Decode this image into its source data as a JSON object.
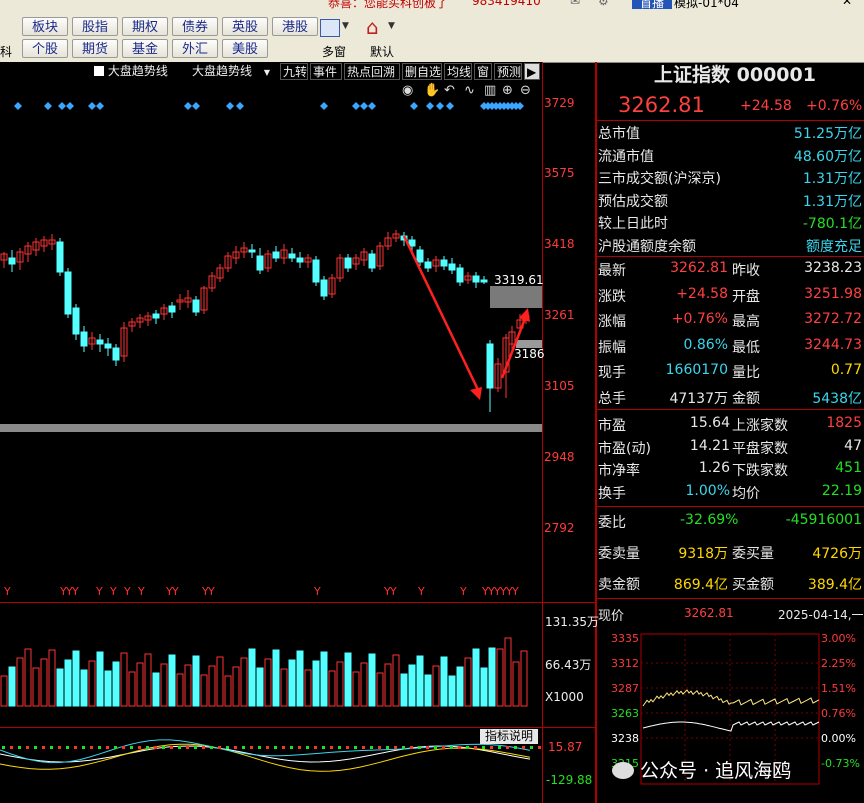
{
  "top_strip": {
    "text": "恭喜：您能买科创板了",
    "code": "983419410",
    "status_btn": "首播",
    "mode": "模拟-01*04"
  },
  "toolbar": {
    "row1": [
      "板块",
      "股指",
      "期权",
      "债券",
      "英股",
      "港股"
    ],
    "row2": [
      "个股",
      "期货",
      "基金",
      "外汇",
      "美股"
    ],
    "side_label": "科",
    "multi_window": "多窗",
    "default": "默认"
  },
  "chart_tools": {
    "checkbox_label": "大盘趋势线",
    "dropdown_label": "大盘趋势线",
    "buttons": [
      "九转",
      "事件",
      "热点回溯",
      "删自选",
      "均线",
      "窗",
      "预测"
    ]
  },
  "price_axis": [
    "3729",
    "3575",
    "3418",
    "3261",
    "3105",
    "2948",
    "2792"
  ],
  "price_marks": {
    "high_label": "3319.61",
    "low_label": "3186"
  },
  "volume_axis": {
    "top": "131.35万",
    "mid": "66.43万",
    "unit": "X1000"
  },
  "indicator": {
    "button": "指标说明",
    "top": "15.87",
    "bottom": "-129.88"
  },
  "y_markers": "Y YYY Y Y Y Y YY YY Y YY Y Y YYYYY",
  "title": "上证指数 000001",
  "price": "3262.81",
  "change": "+24.58",
  "change_pct": "+0.76%",
  "summary": [
    {
      "label": "总市值",
      "value": "51.25万亿",
      "color": "cy"
    },
    {
      "label": "流通市值",
      "value": "48.60万亿",
      "color": "cy"
    },
    {
      "label": "三市成交额(沪深京)",
      "value": "1.31万亿",
      "color": "cy"
    },
    {
      "label": "预估成交额",
      "value": "1.31万亿",
      "color": "cy"
    },
    {
      "label": "较上日此时",
      "value": "-780.1亿",
      "color": "gr"
    },
    {
      "label": "沪股通额度余额",
      "value": "额度充足",
      "color": "cy"
    }
  ],
  "quotes": [
    {
      "l1": "最新",
      "v1": "3262.81",
      "c1": "rd",
      "l2": "昨收",
      "v2": "3238.23",
      "c2": "wh"
    },
    {
      "l1": "涨跌",
      "v1": "+24.58",
      "c1": "rd",
      "l2": "开盘",
      "v2": "3251.98",
      "c2": "rd"
    },
    {
      "l1": "涨幅",
      "v1": "+0.76%",
      "c1": "rd",
      "l2": "最高",
      "v2": "3272.72",
      "c2": "rd"
    },
    {
      "l1": "振幅",
      "v1": "0.86%",
      "c1": "cy",
      "l2": "最低",
      "v2": "3244.73",
      "c2": "rd"
    },
    {
      "l1": "现手",
      "v1": "1660170",
      "c1": "cy",
      "l2": "量比",
      "v2": "0.77",
      "c2": "ye"
    },
    {
      "l1": "总手",
      "v1": "47137万",
      "c1": "wh",
      "l2": "金额",
      "v2": "5438亿",
      "c2": "cy"
    }
  ],
  "stats": [
    {
      "l1": "市盈",
      "v1": "15.64",
      "l2": "上涨家数",
      "v2": "1825",
      "c2": "rd"
    },
    {
      "l1": "市盈(动)",
      "v1": "14.21",
      "l2": "平盘家数",
      "v2": "47",
      "c2": "wh"
    },
    {
      "l1": "市净率",
      "v1": "1.26",
      "l2": "下跌家数",
      "v2": "451",
      "c2": "gr"
    },
    {
      "l1": "换手",
      "v1": "1.00%",
      "l2": "均价",
      "v2": "22.19",
      "c2": "gr"
    }
  ],
  "order": {
    "wb_label": "委比",
    "wb_value": "-32.69%",
    "wb_diff": "-45916001",
    "sell_vol_label": "委卖量",
    "sell_vol": "9318万",
    "buy_vol_label": "委买量",
    "buy_vol": "4726万",
    "sell_amt_label": "卖金额",
    "sell_amt": "869.4亿",
    "buy_amt_label": "买金额",
    "buy_amt": "389.4亿"
  },
  "mini": {
    "label": "现价",
    "price": "3262.81",
    "date": "2025-04-14,一",
    "left_axis": [
      "3335",
      "3312",
      "3287",
      "3263",
      "3238",
      "3215"
    ],
    "right_axis": [
      "3.00%",
      "2.25%",
      "1.51%",
      "0.76%",
      "0.00%",
      "-0.73%"
    ]
  },
  "watermark": "公众号 · 追风海鸥",
  "colors": {
    "up": "#ff3232",
    "down": "#54ffff",
    "axis": "#b00000",
    "bg": "#000000"
  }
}
